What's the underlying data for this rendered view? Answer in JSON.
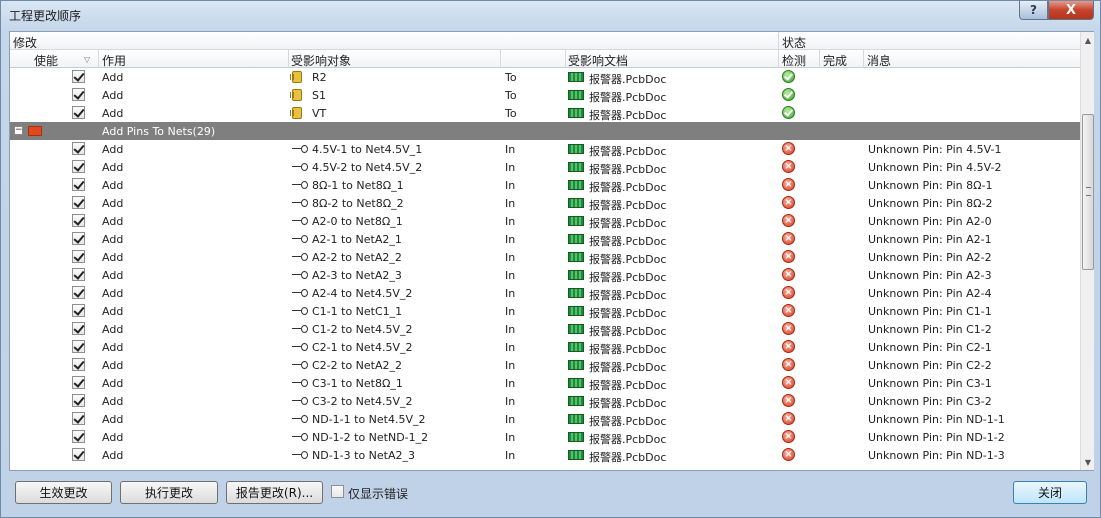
{
  "window": {
    "title": "工程更改顺序",
    "help_label": "?",
    "close_label": "X"
  },
  "header": {
    "group_modify": "修改",
    "group_status": "状态",
    "col_enable": "使能",
    "col_action": "作用",
    "col_affected_object": "受影响对象",
    "col_affected_doc": "受影响文档",
    "col_check": "检测",
    "col_done": "完成",
    "col_message": "消息"
  },
  "rows": [
    {
      "type": "item",
      "action": "Add",
      "icon": "component-icon",
      "object": "R2",
      "dir": "To",
      "doc": "报警器.PcbDoc",
      "status": "ok",
      "message": ""
    },
    {
      "type": "item",
      "action": "Add",
      "icon": "component-icon",
      "object": "S1",
      "dir": "To",
      "doc": "报警器.PcbDoc",
      "status": "ok",
      "message": ""
    },
    {
      "type": "item",
      "action": "Add",
      "icon": "component-icon",
      "object": "VT",
      "dir": "To",
      "doc": "报警器.PcbDoc",
      "status": "ok",
      "message": ""
    },
    {
      "type": "group",
      "expander": "−",
      "label": "Add Pins To Nets(29)"
    },
    {
      "type": "item",
      "action": "Add",
      "icon": "pin-icon",
      "object": "4.5V-1 to Net4.5V_1",
      "dir": "In",
      "doc": "报警器.PcbDoc",
      "status": "err",
      "message": "Unknown Pin: Pin 4.5V-1"
    },
    {
      "type": "item",
      "action": "Add",
      "icon": "pin-icon",
      "object": "4.5V-2 to Net4.5V_2",
      "dir": "In",
      "doc": "报警器.PcbDoc",
      "status": "err",
      "message": "Unknown Pin: Pin 4.5V-2"
    },
    {
      "type": "item",
      "action": "Add",
      "icon": "pin-icon",
      "object": "8Ω-1 to Net8Ω_1",
      "dir": "In",
      "doc": "报警器.PcbDoc",
      "status": "err",
      "message": "Unknown Pin: Pin 8Ω-1"
    },
    {
      "type": "item",
      "action": "Add",
      "icon": "pin-icon",
      "object": "8Ω-2 to Net8Ω_2",
      "dir": "In",
      "doc": "报警器.PcbDoc",
      "status": "err",
      "message": "Unknown Pin: Pin 8Ω-2"
    },
    {
      "type": "item",
      "action": "Add",
      "icon": "pin-icon",
      "object": "A2-0 to Net8Ω_1",
      "dir": "In",
      "doc": "报警器.PcbDoc",
      "status": "err",
      "message": "Unknown Pin: Pin A2-0"
    },
    {
      "type": "item",
      "action": "Add",
      "icon": "pin-icon",
      "object": "A2-1 to NetA2_1",
      "dir": "In",
      "doc": "报警器.PcbDoc",
      "status": "err",
      "message": "Unknown Pin: Pin A2-1"
    },
    {
      "type": "item",
      "action": "Add",
      "icon": "pin-icon",
      "object": "A2-2 to NetA2_2",
      "dir": "In",
      "doc": "报警器.PcbDoc",
      "status": "err",
      "message": "Unknown Pin: Pin A2-2"
    },
    {
      "type": "item",
      "action": "Add",
      "icon": "pin-icon",
      "object": "A2-3 to NetA2_3",
      "dir": "In",
      "doc": "报警器.PcbDoc",
      "status": "err",
      "message": "Unknown Pin: Pin A2-3"
    },
    {
      "type": "item",
      "action": "Add",
      "icon": "pin-icon",
      "object": "A2-4 to Net4.5V_2",
      "dir": "In",
      "doc": "报警器.PcbDoc",
      "status": "err",
      "message": "Unknown Pin: Pin A2-4"
    },
    {
      "type": "item",
      "action": "Add",
      "icon": "pin-icon",
      "object": "C1-1 to NetC1_1",
      "dir": "In",
      "doc": "报警器.PcbDoc",
      "status": "err",
      "message": "Unknown Pin: Pin C1-1"
    },
    {
      "type": "item",
      "action": "Add",
      "icon": "pin-icon",
      "object": "C1-2 to Net4.5V_2",
      "dir": "In",
      "doc": "报警器.PcbDoc",
      "status": "err",
      "message": "Unknown Pin: Pin C1-2"
    },
    {
      "type": "item",
      "action": "Add",
      "icon": "pin-icon",
      "object": "C2-1 to Net4.5V_2",
      "dir": "In",
      "doc": "报警器.PcbDoc",
      "status": "err",
      "message": "Unknown Pin: Pin C2-1"
    },
    {
      "type": "item",
      "action": "Add",
      "icon": "pin-icon",
      "object": "C2-2 to NetA2_2",
      "dir": "In",
      "doc": "报警器.PcbDoc",
      "status": "err",
      "message": "Unknown Pin: Pin C2-2"
    },
    {
      "type": "item",
      "action": "Add",
      "icon": "pin-icon",
      "object": "C3-1 to Net8Ω_1",
      "dir": "In",
      "doc": "报警器.PcbDoc",
      "status": "err",
      "message": "Unknown Pin: Pin C3-1"
    },
    {
      "type": "item",
      "action": "Add",
      "icon": "pin-icon",
      "object": "C3-2 to Net4.5V_2",
      "dir": "In",
      "doc": "报警器.PcbDoc",
      "status": "err",
      "message": "Unknown Pin: Pin C3-2"
    },
    {
      "type": "item",
      "action": "Add",
      "icon": "pin-icon",
      "object": "ND-1-1 to Net4.5V_2",
      "dir": "In",
      "doc": "报警器.PcbDoc",
      "status": "err",
      "message": "Unknown Pin: Pin ND-1-1"
    },
    {
      "type": "item",
      "action": "Add",
      "icon": "pin-icon",
      "object": "ND-1-2 to NetND-1_2",
      "dir": "In",
      "doc": "报警器.PcbDoc",
      "status": "err",
      "message": "Unknown Pin: Pin ND-1-2"
    },
    {
      "type": "item",
      "action": "Add",
      "icon": "pin-icon",
      "object": "ND-1-3 to NetA2_3",
      "dir": "In",
      "doc": "报警器.PcbDoc",
      "status": "err",
      "message": "Unknown Pin: Pin ND-1-3"
    }
  ],
  "footer": {
    "validate_label": "生效更改",
    "execute_label": "执行更改",
    "report_label": "报告更改(R)...",
    "only_errors_label": "仅显示错误",
    "close_label": "关闭"
  }
}
